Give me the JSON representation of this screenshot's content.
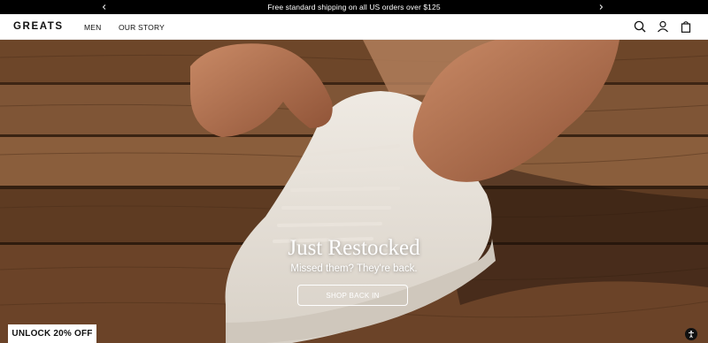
{
  "announcement": {
    "text": "Free standard shipping on all US orders over $125",
    "prev_icon": "chevron-left-icon",
    "next_icon": "chevron-right-icon"
  },
  "header": {
    "logo": "GREATS",
    "nav": [
      {
        "label": "MEN"
      },
      {
        "label": "OUR STORY"
      }
    ],
    "icons": [
      "search-icon",
      "account-icon",
      "bag-icon"
    ]
  },
  "hero": {
    "title": "Just Restocked",
    "subtitle": "Missed them? They're back.",
    "cta": "SHOP BACK IN"
  },
  "promo": {
    "label": "UNLOCK 20% OFF"
  },
  "accessibility": {
    "icon": "accessibility-icon"
  },
  "colors": {
    "announcement_bg": "#000000",
    "header_bg": "#ffffff",
    "text": "#111111",
    "wood": "#6b4429",
    "sneaker": "#ece7e0"
  }
}
